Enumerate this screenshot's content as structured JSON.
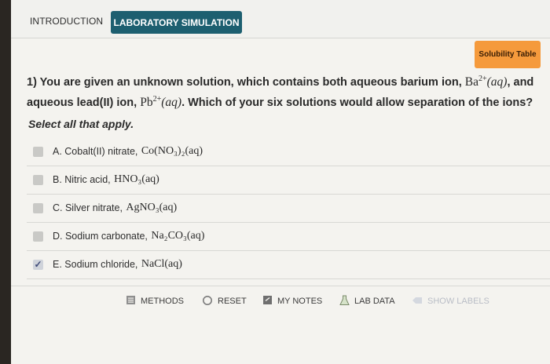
{
  "tabs": {
    "introduction": "INTRODUCTION",
    "laboratory": "LABORATORY SIMULATION"
  },
  "solubility_button": "Solubility Table",
  "question": {
    "line1_prefix": "1) You are given an unknown solution, which contains both aqueous barium ion, ",
    "ba_formula": "Ba",
    "ba_charge": "2+",
    "aq": "(aq)",
    "line1_suffix": ", and",
    "line2_prefix": "aqueous lead(II) ion, ",
    "pb_formula": "Pb",
    "pb_charge": "2+",
    "line2_suffix": ". Which of your six solutions would allow separation of the ions?"
  },
  "instruction": "Select all that apply.",
  "options": [
    {
      "label": "A. Cobalt(II) nitrate, ",
      "formula": "Co(NO₃)₂(aq)",
      "checked": false
    },
    {
      "label": "B. Nitric acid, ",
      "formula": "HNO₃(aq)",
      "checked": false
    },
    {
      "label": "C. Silver nitrate, ",
      "formula": "AgNO₃(aq)",
      "checked": false
    },
    {
      "label": "D. Sodium carbonate, ",
      "formula": "Na₂CO₃(aq)",
      "checked": false
    },
    {
      "label": "E. Sodium chloride, ",
      "formula": "NaCl(aq)",
      "checked": true
    }
  ],
  "footer": {
    "methods": "METHODS",
    "reset": "RESET",
    "my_notes": "MY NOTES",
    "lab_data": "LAB DATA",
    "show_labels": "SHOW LABELS"
  },
  "check_glyph": "✓",
  "icons": [
    "methods-icon",
    "reset-icon",
    "notes-icon",
    "lab-data-icon",
    "show-labels-icon"
  ]
}
